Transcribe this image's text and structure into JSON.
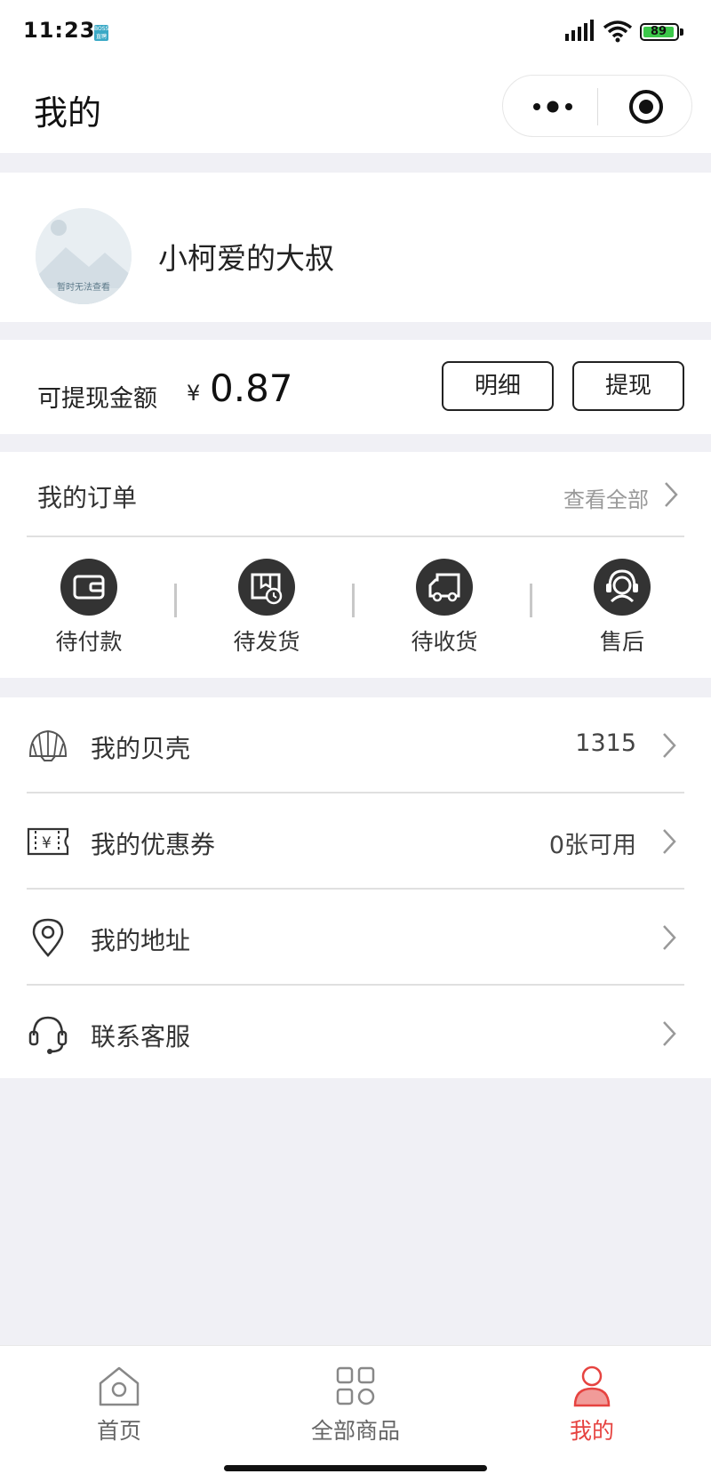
{
  "status_bar": {
    "time": "11:23",
    "battery": "89"
  },
  "nav": {
    "title": "我的"
  },
  "profile": {
    "username": "小柯爱的大叔 ",
    "avatar_text": "暂时无法查看"
  },
  "balance": {
    "label": "可提现金额",
    "currency": "¥",
    "amount": "0.87",
    "detail_button": "明细",
    "withdraw_button": "提现"
  },
  "orders": {
    "title": "我的订单",
    "view_all": "查看全部",
    "items": [
      {
        "label": "待付款",
        "icon": "wallet-icon"
      },
      {
        "label": "待发货",
        "icon": "package-clock-icon"
      },
      {
        "label": "待收货",
        "icon": "truck-icon"
      },
      {
        "label": "售后",
        "icon": "headset-agent-icon"
      }
    ]
  },
  "menu": [
    {
      "label": "我的贝壳",
      "value": "1315",
      "icon": "shell-icon"
    },
    {
      "label": "我的优惠券",
      "value": "0张可用",
      "icon": "coupon-icon"
    },
    {
      "label": "我的地址",
      "value": "",
      "icon": "location-pin-icon"
    },
    {
      "label": "联系客服",
      "value": "",
      "icon": "headset-icon"
    }
  ],
  "tabbar": {
    "items": [
      {
        "label": "首页",
        "icon": "home-icon",
        "active": false
      },
      {
        "label": "全部商品",
        "icon": "grid-icon",
        "active": false
      },
      {
        "label": "我的",
        "icon": "user-icon",
        "active": true
      }
    ]
  },
  "colors": {
    "accent": "#e64340",
    "background": "#f0f0f5",
    "icon_dark": "#333333"
  }
}
